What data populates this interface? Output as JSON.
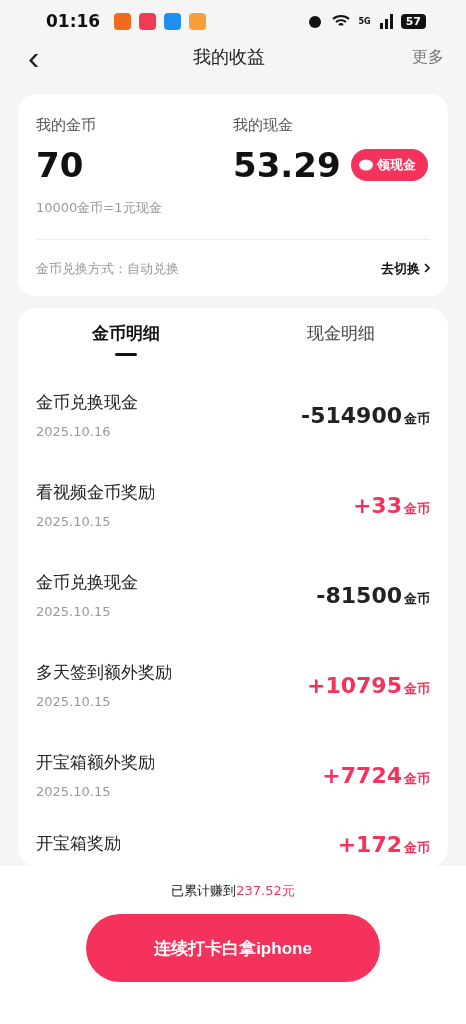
{
  "status_bar": {
    "time": "01:16",
    "battery": "57",
    "network": "5G"
  },
  "nav": {
    "back": "‹",
    "title": "我的收益",
    "more": "更多"
  },
  "summary": {
    "coins_label": "我的金币",
    "coins": "70",
    "cash_label": "我的现金",
    "cash": "53.29",
    "withdraw": "领现金",
    "rate": "10000金币=1元现金",
    "mode_label": "金币兑换方式：自动兑换",
    "switch": "去切换"
  },
  "tabs": [
    {
      "label": "金币明细",
      "selected": true
    },
    {
      "label": "现金明细",
      "selected": false
    }
  ],
  "records": [
    {
      "title": "金币兑换现金",
      "date": "2025.10.16",
      "amount": "-514900",
      "unit": "金币",
      "kind": "expense"
    },
    {
      "title": "看视频金币奖励",
      "date": "2025.10.15",
      "amount": "+33",
      "unit": "金币",
      "kind": "income"
    },
    {
      "title": "金币兑换现金",
      "date": "2025.10.15",
      "amount": "-81500",
      "unit": "金币",
      "kind": "expense"
    },
    {
      "title": "多天签到额外奖励",
      "date": "2025.10.15",
      "amount": "+10795",
      "unit": "金币",
      "kind": "income"
    },
    {
      "title": "开宝箱额外奖励",
      "date": "2025.10.15",
      "amount": "+7724",
      "unit": "金币",
      "kind": "income"
    },
    {
      "title": "开宝箱奖励",
      "amount": "+172",
      "unit": "金币",
      "kind": "income"
    }
  ],
  "footer": {
    "earned_label": "已累计赚到",
    "earned": "237.52元",
    "button": "连续打卡白拿iphone"
  }
}
